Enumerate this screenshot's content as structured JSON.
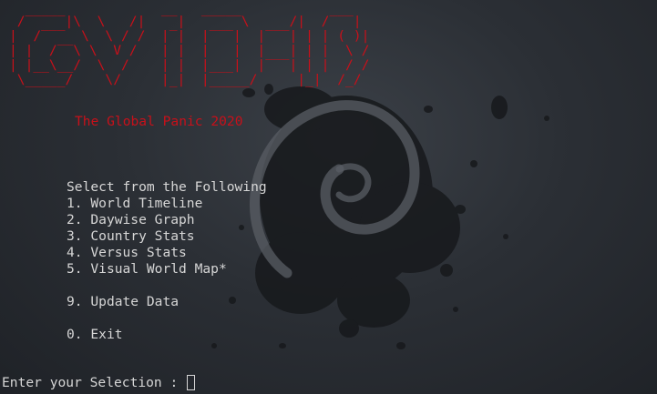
{
  "window": {
    "app": "terminal"
  },
  "banner": {
    "ascii_art": [
      " /‾‾‾‾‾|\\  \\   /|  ‾‾|  ‾‾‾‾‾\\     /|  /‾‾‾|",
      "|  /‾‾‾  \\  \\ / /  |‾|  |‾‾‾|  |‾‾‾| | | ( )|",
      "| |  /‾‾\\ \\  V /   | |  |   |  |   | | |  \\ /",
      "| |__\\__/  \\  /    | |  |___|  |‾‾‾| | |  / /",
      " \\_____/    \\/     |_|  |_____/     |_|  /_/ "
    ],
    "subtitle": "The Global Panic 2020"
  },
  "menu": {
    "heading": "Select from the Following",
    "items": [
      {
        "number": "1.",
        "label": "World Timeline"
      },
      {
        "number": "2.",
        "label": "Daywise Graph"
      },
      {
        "number": "3.",
        "label": "Country Stats"
      },
      {
        "number": "4.",
        "label": "Versus Stats"
      },
      {
        "number": "5.",
        "label": "Visual World Map*"
      }
    ],
    "update": {
      "number": "9.",
      "label": "Update Data"
    },
    "exit": {
      "number": "0.",
      "label": "Exit"
    }
  },
  "prompt": {
    "text": "Enter your Selection : ",
    "input_value": ""
  },
  "colors": {
    "banner": "#c8101a",
    "text": "#d6d6d6",
    "background": "#2b2f35",
    "wallpaper_swirl": "#5a5e64"
  },
  "icons": {
    "wallpaper": "debian-swirl-splatter"
  }
}
